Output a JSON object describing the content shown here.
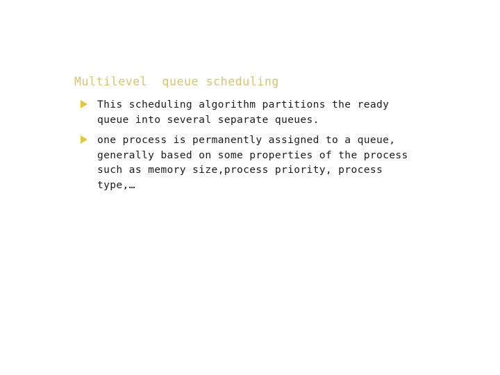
{
  "slide": {
    "title": "Multilevel  queue scheduling",
    "title_color": "#d6c472",
    "background_color": "#ffffff",
    "body_text_color": "#1a1a1a",
    "bullet_marker_color": "#e3c63f",
    "bullets": [
      {
        "marker": "triangle-right-bullet-icon",
        "text": "This scheduling algorithm partitions the ready\nqueue into several separate queues."
      },
      {
        "marker": "triangle-right-bullet-icon",
        "text": "one process is permanently assigned to a queue,\ngenerally based on some properties of the process\nsuch as memory size,process priority, process\ntype,…"
      }
    ]
  }
}
